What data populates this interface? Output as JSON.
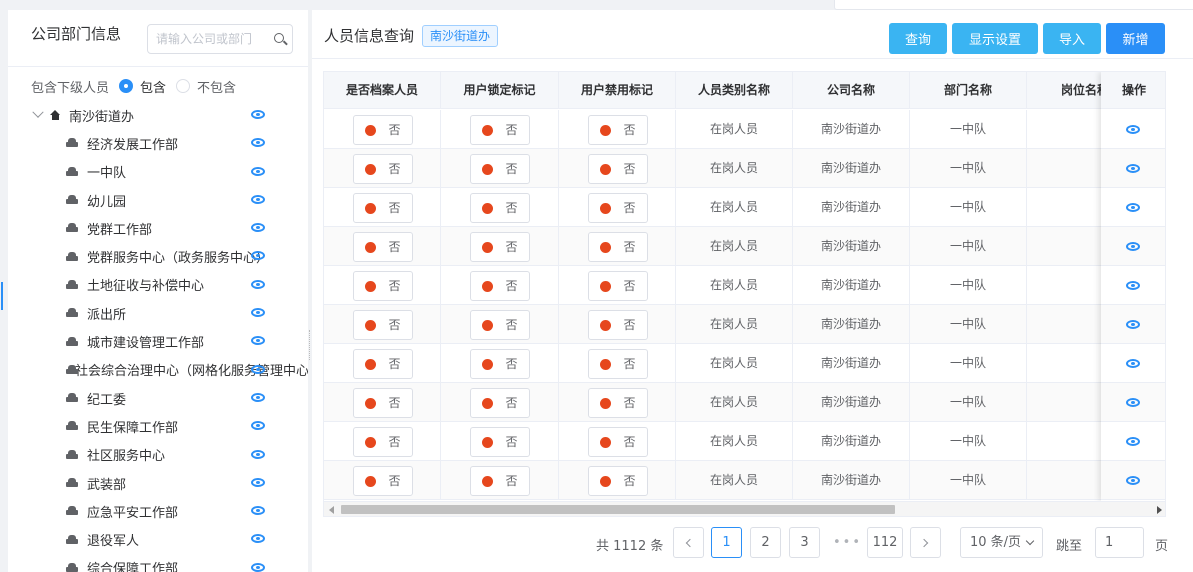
{
  "left_panel": {
    "title": "公司部门信息",
    "search_placeholder": "请输入公司或部门",
    "include_label": "包含下级人员",
    "include_option": "包含",
    "exclude_option": "不包含",
    "include_selected": "包含",
    "tree_root": "南沙街道办",
    "tree_children": [
      "经济发展工作部",
      "一中队",
      "幼儿园",
      "党群工作部",
      "党群服务中心（政务服务中心）",
      "土地征收与补偿中心",
      "派出所",
      "城市建设管理工作部",
      "社会综合治理中心（网格化服务管理中心）",
      "纪工委",
      "民生保障工作部",
      "社区服务中心",
      "武装部",
      "应急平安工作部",
      "退役军人",
      "综合保障工作部"
    ]
  },
  "right_panel": {
    "title": "人员信息查询",
    "tag": "南沙街道办",
    "buttons": {
      "query": "查询",
      "display_settings": "显示设置",
      "import": "导入",
      "add": "新增"
    },
    "table": {
      "columns": [
        "是否档案人员",
        "用户锁定标记",
        "用户禁用标记",
        "人员类别名称",
        "公司名称",
        "部门名称",
        "岗位名称",
        "操作"
      ],
      "rows": [
        {
          "archive": "否",
          "locked": "否",
          "disabled": "否",
          "category": "在岗人员",
          "company": "南沙街道办",
          "department": "一中队",
          "position": ""
        },
        {
          "archive": "否",
          "locked": "否",
          "disabled": "否",
          "category": "在岗人员",
          "company": "南沙街道办",
          "department": "一中队",
          "position": ""
        },
        {
          "archive": "否",
          "locked": "否",
          "disabled": "否",
          "category": "在岗人员",
          "company": "南沙街道办",
          "department": "一中队",
          "position": ""
        },
        {
          "archive": "否",
          "locked": "否",
          "disabled": "否",
          "category": "在岗人员",
          "company": "南沙街道办",
          "department": "一中队",
          "position": ""
        },
        {
          "archive": "否",
          "locked": "否",
          "disabled": "否",
          "category": "在岗人员",
          "company": "南沙街道办",
          "department": "一中队",
          "position": ""
        },
        {
          "archive": "否",
          "locked": "否",
          "disabled": "否",
          "category": "在岗人员",
          "company": "南沙街道办",
          "department": "一中队",
          "position": ""
        },
        {
          "archive": "否",
          "locked": "否",
          "disabled": "否",
          "category": "在岗人员",
          "company": "南沙街道办",
          "department": "一中队",
          "position": ""
        },
        {
          "archive": "否",
          "locked": "否",
          "disabled": "否",
          "category": "在岗人员",
          "company": "南沙街道办",
          "department": "一中队",
          "position": ""
        },
        {
          "archive": "否",
          "locked": "否",
          "disabled": "否",
          "category": "在岗人员",
          "company": "南沙街道办",
          "department": "一中队",
          "position": ""
        },
        {
          "archive": "否",
          "locked": "否",
          "disabled": "否",
          "category": "在岗人员",
          "company": "南沙街道办",
          "department": "一中队",
          "position": ""
        }
      ]
    },
    "pagination": {
      "total_text": "共 1112 条",
      "pages": [
        "1",
        "2",
        "3"
      ],
      "current_page": "1",
      "ellipsis": "•••",
      "last_page": "112",
      "page_size": "10 条/页",
      "goto_label": "跳至",
      "goto_value": "1",
      "page_suffix": "页"
    }
  },
  "colors": {
    "primary": "#2a8ff7",
    "light_button": "#3ab4f2",
    "status_red": "#e6471d"
  },
  "icons": [
    "search-icon",
    "home-icon",
    "car-icon",
    "eye-icon",
    "chevron-left-icon",
    "chevron-right-icon",
    "chevron-down-icon"
  ]
}
